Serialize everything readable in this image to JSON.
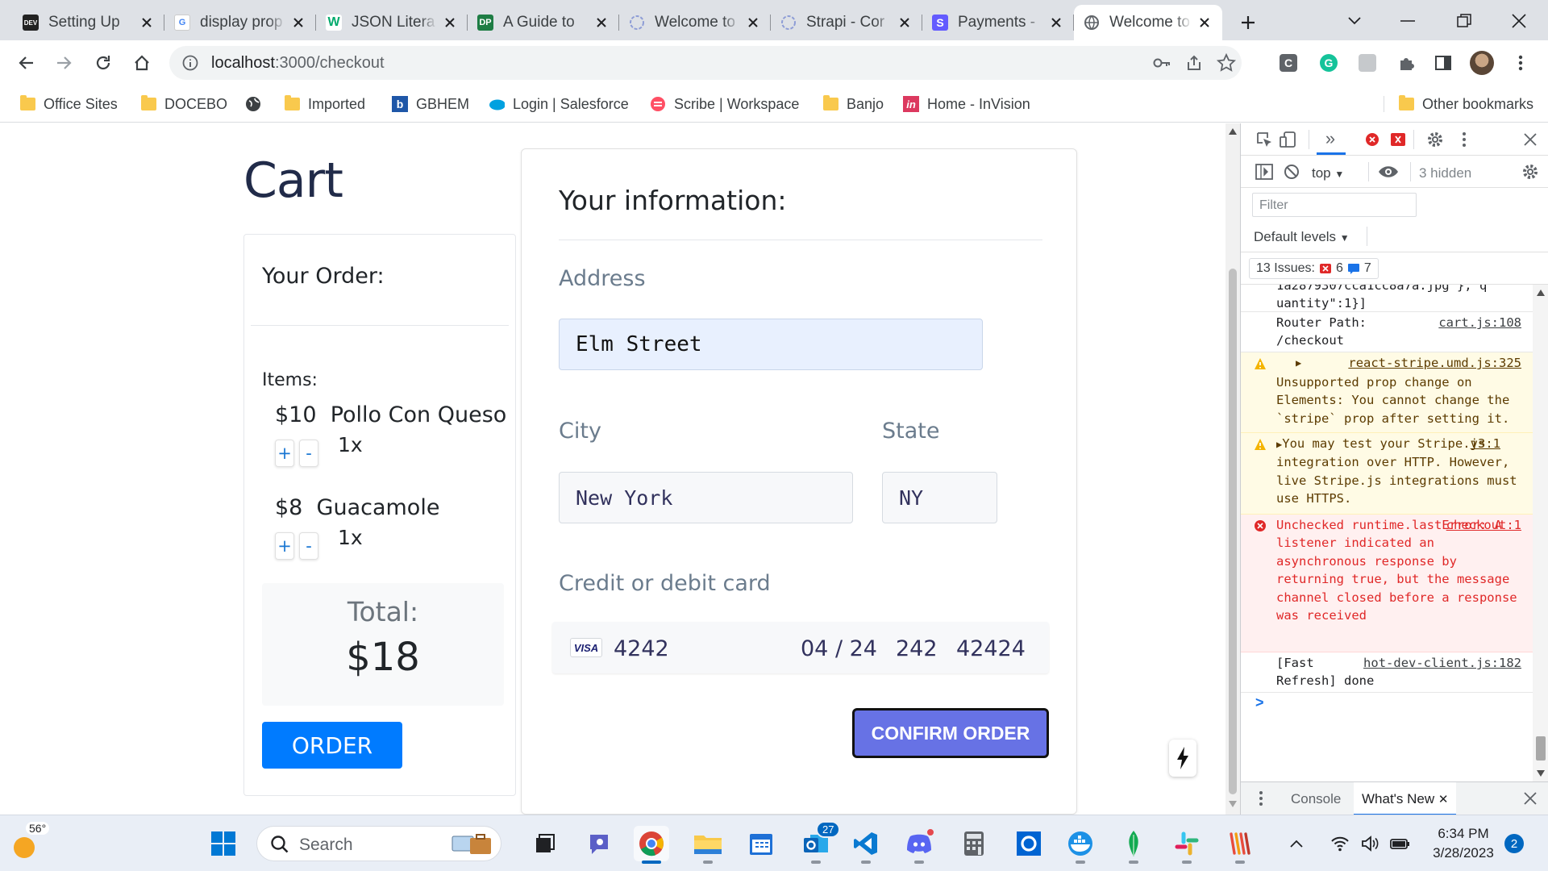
{
  "browser": {
    "tabs": [
      {
        "title": "Setting Up",
        "favicon": "dev-icon",
        "active": false
      },
      {
        "title": "display prop",
        "favicon": "google-icon",
        "active": false
      },
      {
        "title": "JSON Litera",
        "favicon": "w3-icon",
        "active": false
      },
      {
        "title": "A Guide to",
        "favicon": "dp-icon",
        "active": false
      },
      {
        "title": "Welcome to",
        "favicon": "strapi-icon",
        "active": false
      },
      {
        "title": "Strapi - Cor",
        "favicon": "strapi-icon",
        "active": false
      },
      {
        "title": "Payments -",
        "favicon": "stripe-icon",
        "active": false
      },
      {
        "title": "Welcome to",
        "favicon": "globe-icon",
        "active": true
      }
    ],
    "url_prefix": "localhost",
    "url_rest": ":3000/checkout",
    "bookmarks": [
      {
        "label": "Office Sites",
        "icon": "folder-icon"
      },
      {
        "label": "DOCEBO",
        "icon": "folder-icon"
      },
      {
        "label": "",
        "icon": "globe-icon"
      },
      {
        "label": "Imported",
        "icon": "folder-icon"
      },
      {
        "label": "GBHEM",
        "icon": "b-icon"
      },
      {
        "label": "Login | Salesforce",
        "icon": "salesforce-icon"
      },
      {
        "label": "Scribe | Workspace",
        "icon": "scribe-icon"
      },
      {
        "label": "Banjo",
        "icon": "folder-icon"
      },
      {
        "label": "Home - InVision",
        "icon": "invision-icon"
      }
    ],
    "other_bookmarks": "Other bookmarks"
  },
  "cart": {
    "title": "Cart",
    "order_heading": "Your Order:",
    "items_label": "Items:",
    "items": [
      {
        "price": "$10",
        "name": "Pollo Con Queso",
        "qty": "1x"
      },
      {
        "price": "$8",
        "name": "Guacamole",
        "qty": "1x"
      }
    ],
    "plus": "+",
    "minus": "-",
    "total_label": "Total:",
    "total_value": "$18",
    "order_button": "ORDER"
  },
  "checkout": {
    "heading": "Your information:",
    "address_label": "Address",
    "address_value": "Elm Street",
    "city_label": "City",
    "city_value": "New York",
    "state_label": "State",
    "state_value": "NY",
    "card_label": "Credit or debit card",
    "card_brand": "VISA",
    "card_number": "4242",
    "card_expiry": "04 / 24",
    "card_cvc": "242",
    "card_zip": "42424",
    "confirm_button": "CONFIRM ORDER"
  },
  "devtools": {
    "context": "top",
    "hidden": "3 hidden",
    "filter_placeholder": "Filter",
    "levels": "Default levels",
    "issues_label": "13 Issues:",
    "issues_errors": "6",
    "issues_info": "7",
    "messages": [
      {
        "level": "log",
        "text": "1a2879307cca1cc8a7a.jpg\"},\"q uantity\":1}]",
        "source": ""
      },
      {
        "level": "log",
        "text": "Router Path: /checkout",
        "source": "cart.js:108"
      },
      {
        "level": "warn",
        "text": "Unsupported prop change on Elements: You cannot change the `stripe` prop after setting it.",
        "source": "react-stripe.umd.js:325"
      },
      {
        "level": "warn",
        "text": "You may test your Stripe.js integration over HTTP. However, live Stripe.js integrations must use HTTPS.",
        "source": "v3:1"
      },
      {
        "level": "error",
        "text": "Unchecked runtime.lastError: A listener indicated an asynchronous response by returning true, but the message channel closed before a response was received",
        "source": "checkout:1"
      },
      {
        "level": "log",
        "text": "[Fast Refresh] done",
        "source": "hot-dev-client.js:182"
      }
    ],
    "prompt": ">",
    "drawer_tabs": [
      "Console",
      "What's New"
    ]
  },
  "taskbar": {
    "weather_temp": "56°",
    "search_label": "Search",
    "teams_badge": "27",
    "time": "6:34 PM",
    "date": "3/28/2023",
    "notifications": "2"
  }
}
